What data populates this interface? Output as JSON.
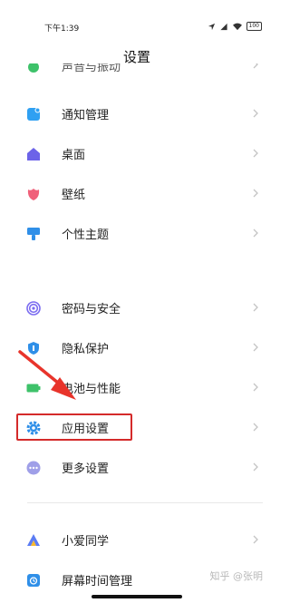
{
  "status_bar": {
    "time": "下午1:39",
    "battery": "100"
  },
  "page": {
    "title": "设置"
  },
  "settings": {
    "partial_item": {
      "label": "声音与振动"
    },
    "items": [
      {
        "label": "通知管理",
        "icon": "notification-icon",
        "color": "#2fa0f2"
      },
      {
        "label": "桌面",
        "icon": "home-icon",
        "color": "#6c63e8"
      },
      {
        "label": "壁纸",
        "icon": "wallpaper-icon",
        "color": "#f0607a"
      },
      {
        "label": "个性主题",
        "icon": "theme-icon",
        "color": "#2f8fe8"
      },
      {
        "label": "密码与安全",
        "icon": "fingerprint-icon",
        "color": "#7b6cf0"
      },
      {
        "label": "隐私保护",
        "icon": "privacy-icon",
        "color": "#2f8fe8"
      },
      {
        "label": "电池与性能",
        "icon": "battery-icon",
        "color": "#3ec26a"
      },
      {
        "label": "应用设置",
        "icon": "gear-icon",
        "color": "#2f8fe8"
      },
      {
        "label": "更多设置",
        "icon": "more-icon",
        "color": "#9f9fe8"
      },
      {
        "label": "小爱同学",
        "icon": "xiaoai-icon",
        "color": "#5b7cf3"
      },
      {
        "label": "屏幕时间管理",
        "icon": "screen-time-icon",
        "color": "#2f8fe8"
      }
    ]
  },
  "annotation": {
    "highlight_color": "#d42a2a",
    "arrow_color": "#e8342b"
  },
  "watermark": {
    "text": "知乎 @张明"
  }
}
